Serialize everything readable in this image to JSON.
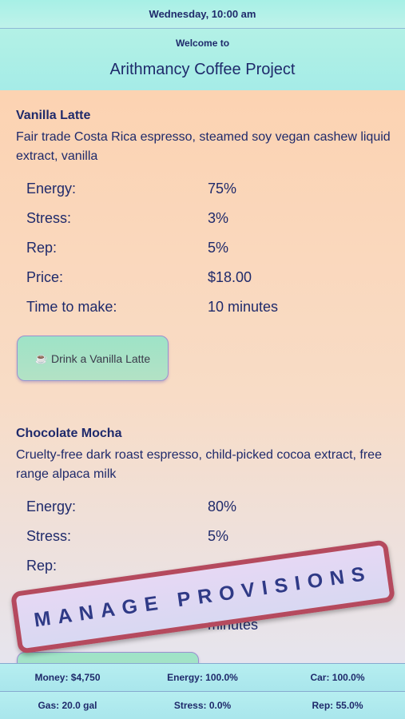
{
  "topbar": {
    "datetime": "Wednesday, 10:00 am"
  },
  "header": {
    "welcome": "Welcome to",
    "title": "Arithmancy Coffee Project"
  },
  "items": [
    {
      "name": "Vanilla Latte",
      "description": "Fair trade Costa Rica espresso, steamed soy vegan cashew liquid extract, vanilla",
      "stats": [
        {
          "label": "Energy:",
          "value": "75%"
        },
        {
          "label": "Stress:",
          "value": "3%"
        },
        {
          "label": "Rep:",
          "value": "5%"
        },
        {
          "label": "Price:",
          "value": "$18.00"
        },
        {
          "label": "Time to make:",
          "value": "10 minutes"
        }
      ],
      "button_icon": "coffee-cup-icon",
      "button_label": "Drink a Vanilla Latte"
    },
    {
      "name": "Chocolate Mocha",
      "description": "Cruelty-free dark roast espresso, child-picked cocoa extract, free range alpaca milk",
      "stats": [
        {
          "label": "Energy:",
          "value": "80%"
        },
        {
          "label": "Stress:",
          "value": "5%"
        },
        {
          "label": "Rep:",
          "value": ""
        },
        {
          "label": "",
          "value": ""
        },
        {
          "label": "",
          "value": "minutes"
        }
      ]
    }
  ],
  "banner": {
    "label": "MANAGE PROVISIONS"
  },
  "status": {
    "money": "Money: $4,750",
    "energy": "Energy: 100.0%",
    "car": "Car: 100.0%",
    "gas": "Gas: 20.0 gal",
    "stress": "Stress: 0.0%",
    "rep": "Rep: 55.0%"
  },
  "colors": {
    "accent": "#1f2a6b",
    "banner_border": "#b54a5e",
    "header_bg": "#a7f0e6"
  }
}
